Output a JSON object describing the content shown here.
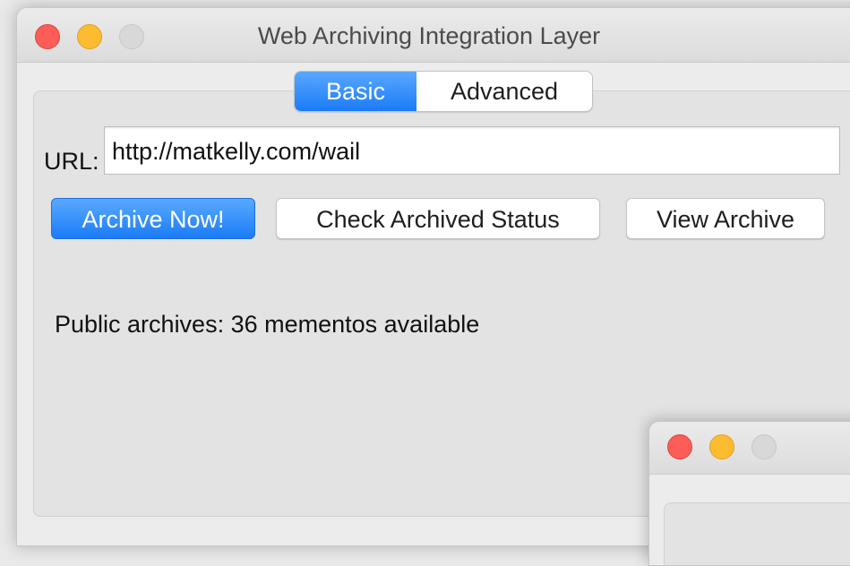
{
  "window": {
    "title": "Web Archiving Integration Layer"
  },
  "tabs": [
    {
      "label": "Basic",
      "active": true
    },
    {
      "label": "Advanced",
      "active": false
    }
  ],
  "form": {
    "url_label": "URL:",
    "url_value": "http://matkelly.com/wail"
  },
  "buttons": {
    "archive_now": "Archive Now!",
    "check_status": "Check Archived Status",
    "view_archive": "View Archive"
  },
  "status": {
    "text": "Public archives: 36 mementos available"
  },
  "colors": {
    "accent": "#1b7cf7",
    "close": "#fc5d57",
    "minimize": "#fdbb2f",
    "maximize_disabled": "#d8d8d8"
  }
}
